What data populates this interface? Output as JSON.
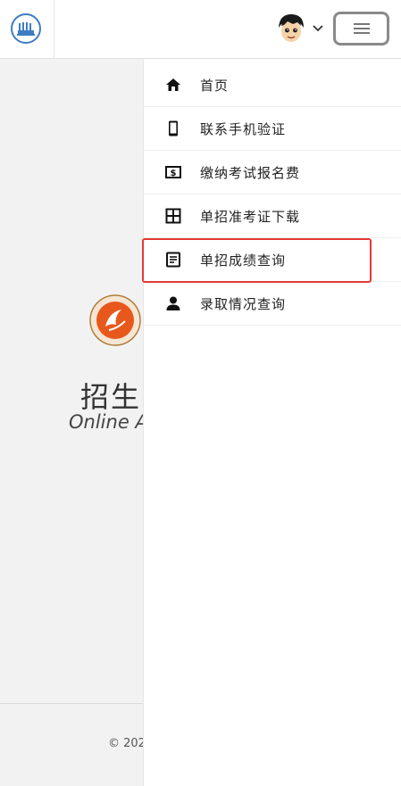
{
  "header": {
    "logo_icon": "school-logo-icon",
    "avatar_icon": "user-avatar-icon",
    "dropdown_icon": "chevron-down-icon",
    "menu_icon": "hamburger-menu-icon"
  },
  "background": {
    "title": "招生·",
    "subtitle": "Online A",
    "copyright": "© 202"
  },
  "menu": {
    "items": [
      {
        "label": "首页",
        "icon": "home-icon"
      },
      {
        "label": "联系手机验证",
        "icon": "mobile-phone-icon"
      },
      {
        "label": "缴纳考试报名费",
        "icon": "payment-icon"
      },
      {
        "label": "单招准考证下载",
        "icon": "grid-icon"
      },
      {
        "label": "单招成绩查询",
        "icon": "document-icon"
      },
      {
        "label": "录取情况查询",
        "icon": "person-icon"
      }
    ]
  },
  "colors": {
    "highlight": "#e53935",
    "logo_blue": "#3f7cc2",
    "emblem_orange": "#e8581c"
  }
}
